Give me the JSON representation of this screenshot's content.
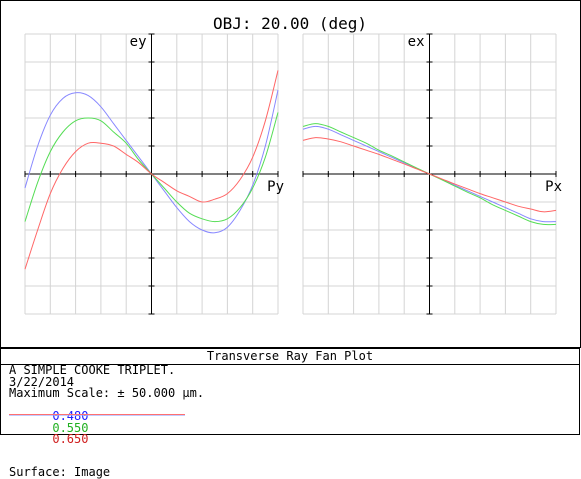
{
  "header": {
    "title": "OBJ: 20.00 (deg)"
  },
  "panels": [
    {
      "y_label": "ey",
      "x_label": "Py"
    },
    {
      "y_label": "ex",
      "x_label": "Px"
    }
  ],
  "info": {
    "plot_title": "Transverse Ray Fan Plot",
    "lens_name": "A SIMPLE COOKE TRIPLET.",
    "date": "3/22/2014",
    "max_scale": "Maximum Scale: ± 50.000 µm.",
    "wavelengths": [
      {
        "value": "0.480",
        "color": "#2020ff"
      },
      {
        "value": "0.550",
        "color": "#20b020"
      },
      {
        "value": "0.650",
        "color": "#d02020"
      }
    ],
    "surface": "Surface: Image"
  },
  "chart_data": [
    {
      "type": "line",
      "title": "OBJ: 20.00 (deg)",
      "ylabel": "ey",
      "xlabel": "Py",
      "xlim": [
        -1,
        1
      ],
      "ylim": [
        -50,
        50
      ],
      "grid": true,
      "x": [
        -1.0,
        -0.9,
        -0.8,
        -0.7,
        -0.6,
        -0.5,
        -0.4,
        -0.3,
        -0.2,
        -0.1,
        0.0,
        0.1,
        0.2,
        0.3,
        0.4,
        0.5,
        0.6,
        0.7,
        0.8,
        0.9,
        1.0
      ],
      "series": [
        {
          "name": "0.480",
          "color": "#8888ff",
          "values": [
            -5,
            10,
            21,
            27,
            29,
            28,
            24,
            18,
            12,
            6,
            0,
            -6,
            -12,
            -17,
            -20,
            -21,
            -19,
            -13,
            -4,
            10,
            30
          ]
        },
        {
          "name": "0.550",
          "color": "#55dd55",
          "values": [
            -17,
            -3,
            8,
            15,
            19,
            20,
            19,
            15,
            11,
            5,
            0,
            -5,
            -10,
            -14,
            -16,
            -17,
            -16,
            -12,
            -5,
            6,
            22
          ]
        },
        {
          "name": "0.650",
          "color": "#ff6666",
          "values": [
            -34,
            -20,
            -7,
            2,
            8,
            11,
            11,
            10,
            7,
            4,
            0,
            -3,
            -6,
            -8,
            -10,
            -9,
            -7,
            -2,
            6,
            19,
            37
          ]
        }
      ]
    },
    {
      "type": "line",
      "ylabel": "ex",
      "xlabel": "Px",
      "xlim": [
        0,
        1
      ],
      "ylim": [
        -50,
        50
      ],
      "grid": true,
      "x": [
        -1.0,
        -0.9,
        -0.8,
        -0.7,
        -0.6,
        -0.5,
        -0.4,
        -0.3,
        -0.2,
        -0.1,
        0.0,
        0.1,
        0.2,
        0.3,
        0.4,
        0.5,
        0.6,
        0.7,
        0.8,
        0.9,
        1.0
      ],
      "series": [
        {
          "name": "0.480",
          "color": "#8888ff",
          "values": [
            16,
            17,
            16,
            14,
            12,
            10,
            8,
            6,
            4,
            2,
            0,
            -2,
            -4,
            -6,
            -8,
            -10,
            -12,
            -14,
            -16,
            -17,
            -17
          ]
        },
        {
          "name": "0.550",
          "color": "#55dd55",
          "values": [
            17,
            18,
            17,
            15,
            13,
            11,
            8.5,
            6.5,
            4.3,
            2.1,
            0,
            -2.1,
            -4.3,
            -6.5,
            -8.5,
            -11,
            -13,
            -15,
            -17,
            -18,
            -18
          ]
        },
        {
          "name": "0.650",
          "color": "#ff6666",
          "values": [
            12,
            13,
            12.5,
            11.5,
            10,
            8.5,
            7,
            5.3,
            3.6,
            1.8,
            0,
            -1.8,
            -3.6,
            -5.3,
            -7,
            -8.5,
            -10,
            -11.5,
            -12.5,
            -13.5,
            -13
          ]
        }
      ]
    }
  ]
}
